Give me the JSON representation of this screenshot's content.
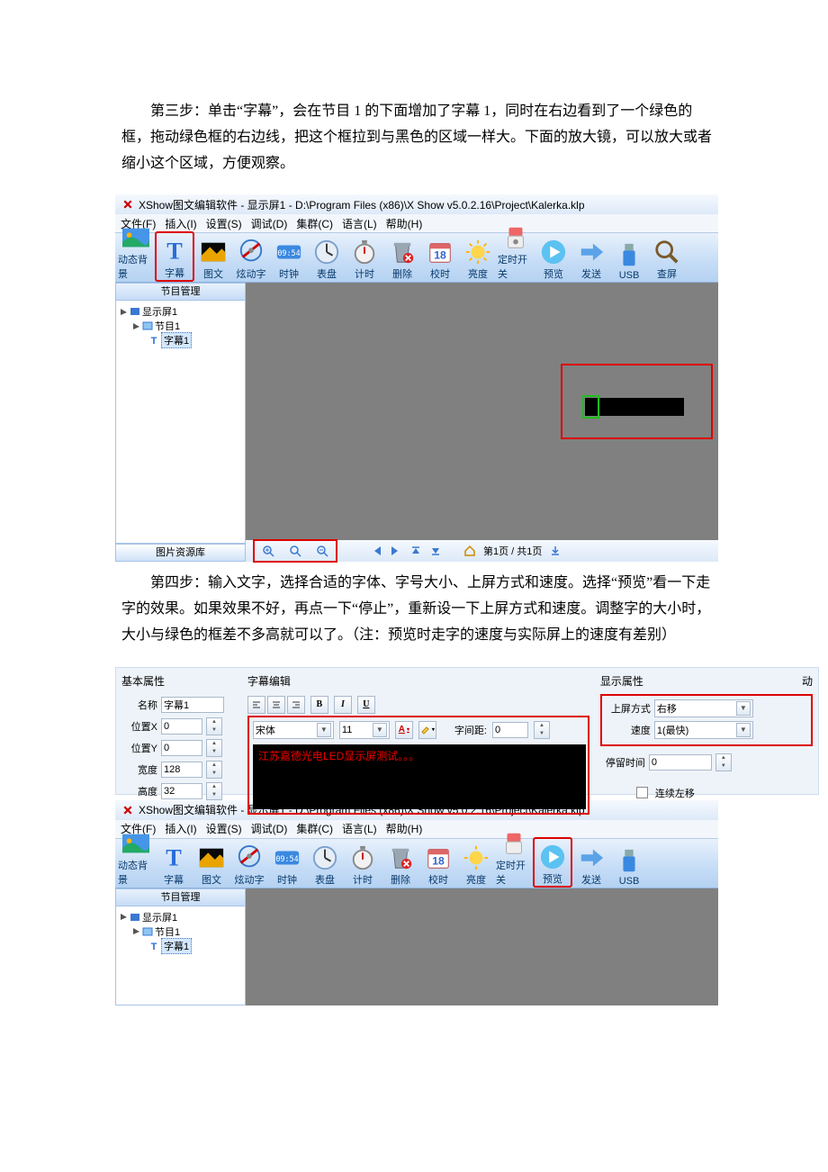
{
  "para1": "第三步：单击“字幕”，会在节目 1 的下面增加了字幕 1，同时在右边看到了一个绿色的框，拖动绿色框的右边线，把这个框拉到与黑色的区域一样大。下面的放大镜，可以放大或者缩小这个区域，方便观察。",
  "para2": "第四步：输入文字，选择合适的字体、字号大小、上屏方式和速度。选择“预览”看一下走字的效果。如果效果不好，再点一下“停止”，重新设一下上屏方式和速度。调整字的大小时，大小与绿色的框差不多高就可以了。（注：预览时走字的速度与实际屏上的速度有差别）",
  "title": "XShow图文编辑软件 - 显示屏1 - D:\\Program Files (x86)\\X Show v5.0.2.16\\Project\\Kalerka.klp",
  "menu": {
    "file": "文件(F)",
    "insert": "插入(I)",
    "set": "设置(S)",
    "debug": "调试(D)",
    "group": "集群(C)",
    "lang": "语言(L)",
    "help": "帮助(H)"
  },
  "tool": {
    "bg": "动态背景",
    "sub": "字幕",
    "pic": "图文",
    "fx": "炫动字",
    "clock": "时钟",
    "dial": "表盘",
    "timer": "计时",
    "del": "删除",
    "cal": "校时",
    "bright": "亮度",
    "sw": "定时开关",
    "prev": "预览",
    "send": "发送",
    "usb": "USB",
    "find": "查屏"
  },
  "treehd": "节目管理",
  "tree": {
    "n1": "显示屏1",
    "n2": "节目1",
    "n3": "字幕1"
  },
  "lib": "图片资源库",
  "pager": "第1页 / 共1页",
  "prop": {
    "basic": "基本属性",
    "name": "名称",
    "nval": "字幕1",
    "x": "位置X",
    "y": "位置Y",
    "w": "宽度",
    "h": "高度",
    "xv": "0",
    "yv": "0",
    "wv": "128",
    "hv": "32",
    "edit": "字幕编辑",
    "font": "宋体",
    "size": "11",
    "gap": "字间距:",
    "gapv": "0",
    "text": "江苏嘉德光电LED显示屏测试。。。",
    "disp": "显示属性",
    "mode": "上屏方式",
    "mval": "右移",
    "speed": "速度",
    "sval": "1(最快)",
    "stay": "停留时间",
    "stayv": "0",
    "cont": "连续左移",
    "dy": "动"
  }
}
